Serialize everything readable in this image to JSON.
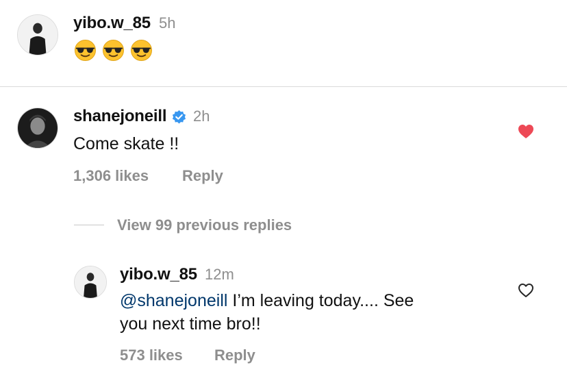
{
  "comments": [
    {
      "username": "yibo.w_85",
      "time": "5h",
      "emojis": [
        "sunglasses-emoji",
        "sunglasses-emoji",
        "sunglasses-emoji"
      ]
    },
    {
      "username": "shanejoneill",
      "verified": true,
      "time": "2h",
      "text": "Come skate !!",
      "likes": "1,306 likes",
      "reply_label": "Reply",
      "liked": true,
      "heart_color": "#ed4956"
    }
  ],
  "view_replies": "View 99 previous replies",
  "reply": {
    "username": "yibo.w_85",
    "time": "12m",
    "mention": "@shanejoneill",
    "text_line1": " I’m leaving today.... See",
    "text_line2": "you next time bro!!",
    "likes": "573 likes",
    "reply_label": "Reply",
    "liked": false
  },
  "colors": {
    "mention": "#00376b",
    "secondary_text": "#8e8e8e",
    "verified_badge": "#3897f0"
  }
}
